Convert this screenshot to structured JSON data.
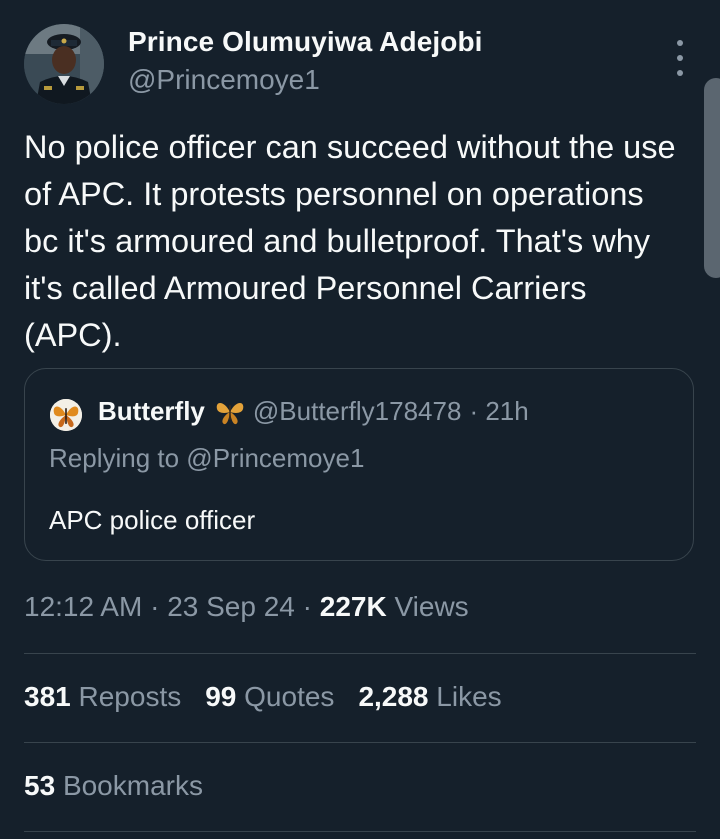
{
  "author": {
    "name": "Prince Olumuyiwa Adejobi",
    "handle": "@Princemoye1"
  },
  "tweet": {
    "text": "No police officer can succeed without the use of APC. It protests personnel on operations bc it's armoured and bulletproof. That's why it's called Armoured Personnel Carriers (APC)."
  },
  "quoted": {
    "name": "Butterfly",
    "handle": "@Butterfly178478",
    "age": "· 21h",
    "replying_to": "Replying to @Princemoye1",
    "text": "APC police officer"
  },
  "meta": {
    "time": "12:12 AM",
    "sep1": "·",
    "date": "23 Sep 24",
    "sep2": "·",
    "views_count": "227K",
    "views_label": "Views"
  },
  "stats": {
    "reposts_count": "381",
    "reposts_label": "Reposts",
    "quotes_count": "99",
    "quotes_label": "Quotes",
    "likes_count": "2,288",
    "likes_label": "Likes",
    "bookmarks_count": "53",
    "bookmarks_label": "Bookmarks"
  },
  "colors": {
    "background": "#15202b",
    "text_primary": "#f7f9f9",
    "text_secondary": "#8b98a5",
    "border": "#38444d"
  },
  "icons": {
    "menu": "more-vertical-icon",
    "quoted_avatar": "butterfly-avatar",
    "name_emoji": "butterfly-emoji"
  }
}
